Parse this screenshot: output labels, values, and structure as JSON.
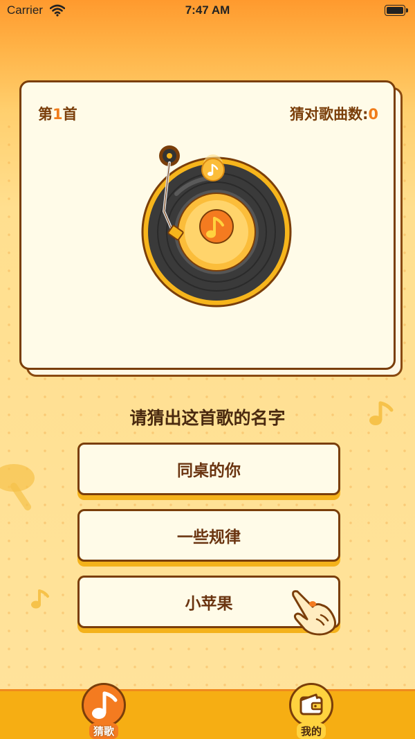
{
  "status_bar": {
    "carrier": "Carrier",
    "time": "7:47 AM"
  },
  "card": {
    "track_prefix": "第",
    "track_number": "1",
    "track_suffix": "首",
    "score_label": "猜对歌曲数:",
    "score_value": "0"
  },
  "question": "请猜出这首歌的名字",
  "options": [
    {
      "label": "同桌的你"
    },
    {
      "label": "一些规律"
    },
    {
      "label": "小苹果"
    }
  ],
  "tab_bar": {
    "tabs": [
      {
        "label": "猜歌",
        "icon": "music-note-icon",
        "selected": true
      },
      {
        "label": "我的",
        "icon": "wallet-icon",
        "selected": false
      }
    ]
  },
  "colors": {
    "accent": "#f07c1a",
    "border": "#7a3e0a",
    "card_bg": "#fffbe8",
    "tab_bar_bg": "#f6ae13"
  }
}
